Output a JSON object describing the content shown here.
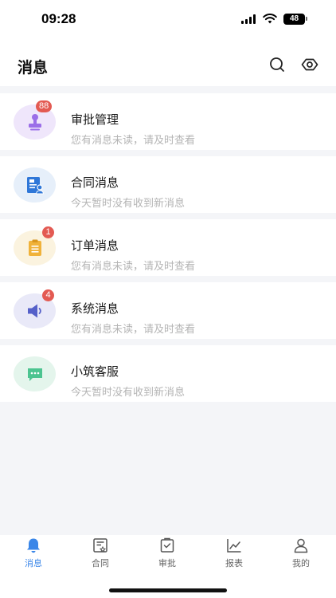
{
  "status_bar": {
    "time": "09:28",
    "battery": "48"
  },
  "header": {
    "title": "消息",
    "search_icon": "search-icon",
    "eye_icon": "eye-icon"
  },
  "messages": [
    {
      "title": "审批管理",
      "subtitle": "您有消息未读，请及时查看",
      "badge": "88",
      "icon": "stamp-icon",
      "avatar_bg": "#efe6fb",
      "icon_color": "#9b6ee8"
    },
    {
      "title": "合同消息",
      "subtitle": "今天暂时没有收到新消息",
      "badge": "",
      "icon": "contract-icon",
      "avatar_bg": "#e6effa",
      "icon_color": "#2f77d8"
    },
    {
      "title": "订单消息",
      "subtitle": "您有消息未读，请及时查看",
      "badge": "1",
      "icon": "clipboard-icon",
      "avatar_bg": "#fbf3df",
      "icon_color": "#f0b23a"
    },
    {
      "title": "系统消息",
      "subtitle": "您有消息未读，请及时查看",
      "badge": "4",
      "icon": "speaker-icon",
      "avatar_bg": "#e9e9f8",
      "icon_color": "#5560c9"
    },
    {
      "title": "小筑客服",
      "subtitle": "今天暂时没有收到新消息",
      "badge": "",
      "icon": "chat-icon",
      "avatar_bg": "#e4f5ec",
      "icon_color": "#4cc490"
    }
  ],
  "tabbar": {
    "tabs": [
      {
        "label": "消息",
        "icon": "bell-icon",
        "active": true
      },
      {
        "label": "合同",
        "icon": "contract-icon",
        "active": false
      },
      {
        "label": "审批",
        "icon": "approval-icon",
        "active": false
      },
      {
        "label": "报表",
        "icon": "chart-icon",
        "active": false
      },
      {
        "label": "我的",
        "icon": "user-icon",
        "active": false
      }
    ]
  },
  "colors": {
    "accent": "#3a86e8",
    "badge": "#e35a52",
    "page_bg": "#f4f5f8",
    "subtitle": "#b4b4b4"
  }
}
